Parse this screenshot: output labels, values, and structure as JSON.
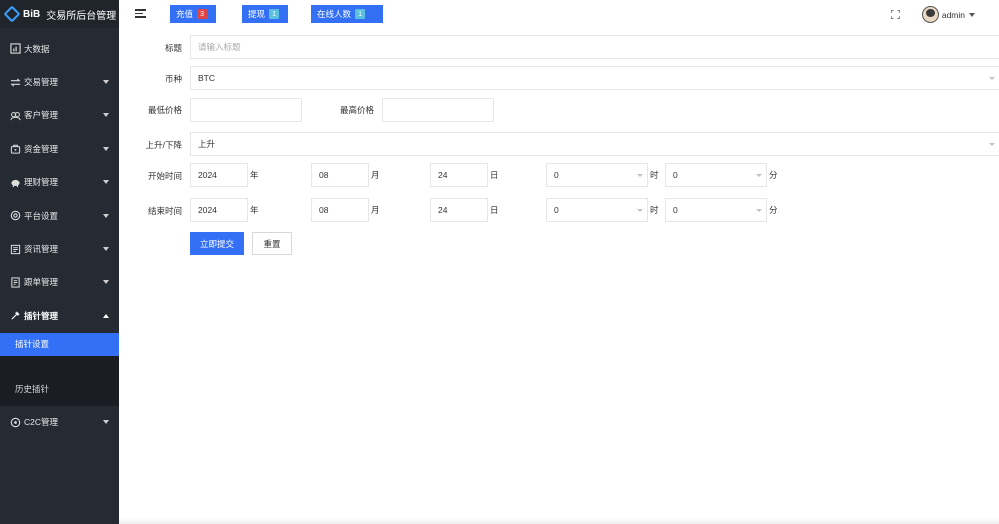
{
  "app": {
    "brand": "BiB",
    "title": "交易所后台管理"
  },
  "sidebar": {
    "items": [
      {
        "label": "大数据",
        "icon": "chart-icon"
      },
      {
        "label": "交易管理",
        "icon": "exchange-icon"
      },
      {
        "label": "客户管理",
        "icon": "users-icon"
      },
      {
        "label": "资金管理",
        "icon": "wallet-icon"
      },
      {
        "label": "理财管理",
        "icon": "piggy-bank-icon"
      },
      {
        "label": "平台设置",
        "icon": "settings-icon"
      },
      {
        "label": "资讯管理",
        "icon": "news-icon"
      },
      {
        "label": "跟单管理",
        "icon": "document-icon"
      },
      {
        "label": "插针管理",
        "icon": "needle-icon"
      },
      {
        "label": "C2C管理",
        "icon": "c2c-icon"
      }
    ],
    "sub_items": [
      "插针设置",
      "历史插针"
    ]
  },
  "header": {
    "recharge": "充值",
    "recharge_count": "3",
    "withdraw": "提现",
    "withdraw_count": "1",
    "online": "在线人数",
    "online_count": "1",
    "username": "admin"
  },
  "form": {
    "title_label": "标题",
    "title_placeholder": "请输入标题",
    "currency_label": "币种",
    "currency_value": "BTC",
    "min_price_label": "最低价格",
    "min_price_value": "",
    "max_price_label": "最高价格",
    "max_price_value": "",
    "direction_label": "上升/下降",
    "direction_value": "上升",
    "start_label": "开始时间",
    "end_label": "结束时间",
    "start": {
      "year": "2024",
      "month": "08",
      "day": "24",
      "hour": "0",
      "minute": "0"
    },
    "end": {
      "year": "2024",
      "month": "08",
      "day": "24",
      "hour": "0",
      "minute": "0"
    },
    "units": {
      "year": "年",
      "month": "月",
      "day": "日",
      "hour": "时",
      "minute": "分"
    },
    "submit": "立即提交",
    "reset": "重置"
  },
  "colors": {
    "primary": "#3370f6",
    "sidebar": "#262b33",
    "badge_red": "#e04545",
    "badge_cyan": "#5bc0de"
  }
}
